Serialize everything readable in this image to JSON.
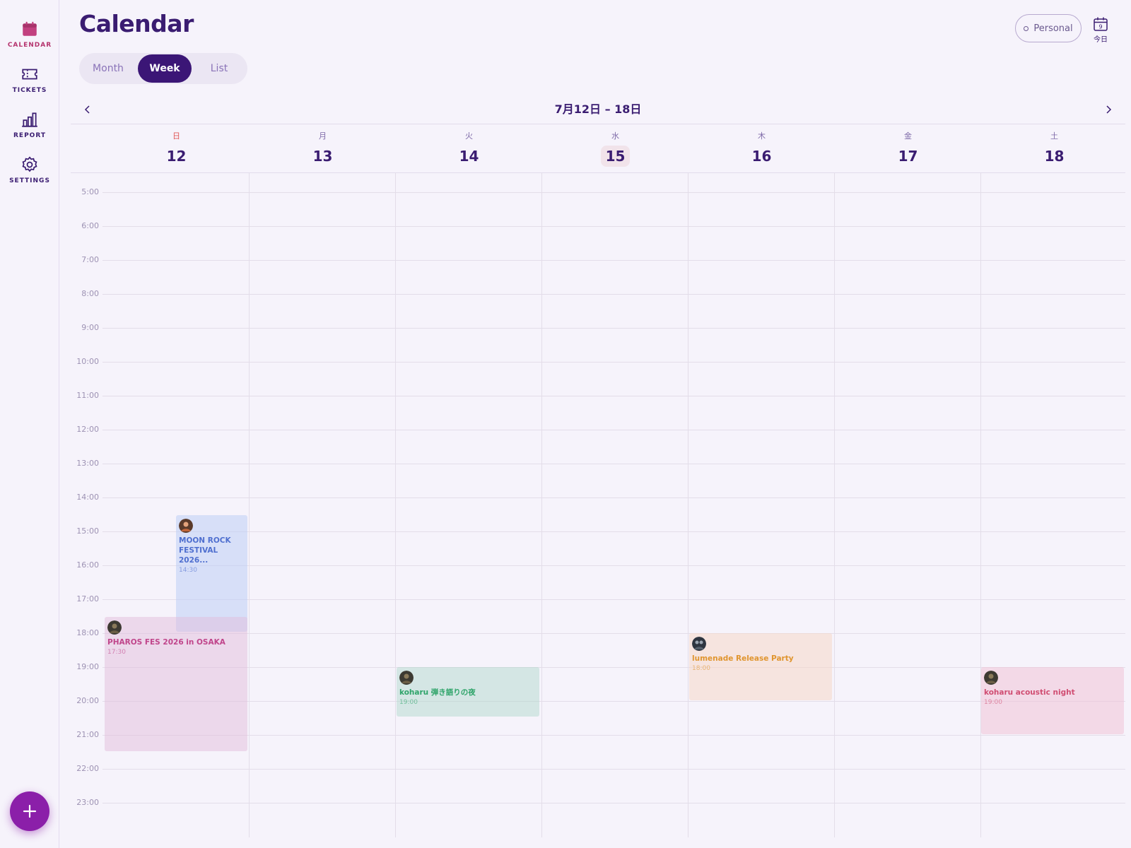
{
  "app": {
    "title": "Calendar"
  },
  "sidebar": {
    "items": [
      {
        "label": "CALENDAR",
        "icon": "calendar-icon",
        "active": true
      },
      {
        "label": "TICKETS",
        "icon": "ticket-icon",
        "active": false
      },
      {
        "label": "REPORT",
        "icon": "bar-chart-icon",
        "active": false
      },
      {
        "label": "SETTINGS",
        "icon": "gear-icon",
        "active": false
      }
    ],
    "fab_icon": "plus-icon"
  },
  "header": {
    "views": [
      "Month",
      "Week",
      "List"
    ],
    "active_view": "Week",
    "filter_label": "Personal",
    "today_label": "今日",
    "today_icon_day": "9"
  },
  "week": {
    "range_title": "7月12日 – 18日",
    "days": [
      {
        "dow": "日",
        "num": "12",
        "today": false
      },
      {
        "dow": "月",
        "num": "13",
        "today": false
      },
      {
        "dow": "火",
        "num": "14",
        "today": false
      },
      {
        "dow": "水",
        "num": "15",
        "today": true
      },
      {
        "dow": "木",
        "num": "16",
        "today": false
      },
      {
        "dow": "金",
        "num": "17",
        "today": false
      },
      {
        "dow": "土",
        "num": "18",
        "today": false
      }
    ],
    "hours": [
      "5:00",
      "6:00",
      "7:00",
      "8:00",
      "9:00",
      "10:00",
      "11:00",
      "12:00",
      "13:00",
      "14:00",
      "15:00",
      "16:00",
      "17:00",
      "18:00",
      "19:00",
      "20:00",
      "21:00",
      "22:00",
      "23:00"
    ]
  },
  "events": [
    {
      "title": "MOON ROCK FESTIVAL 2026...",
      "time": "14:30",
      "day": "12",
      "color": "#4f6fcf"
    },
    {
      "title": "PHAROS FES 2026 in OSAKA",
      "time": "17:30",
      "day": "12",
      "color": "#c0458b"
    },
    {
      "title": "koharu 弾き語りの夜",
      "time": "19:00",
      "day": "14",
      "color": "#2fa46a"
    },
    {
      "title": "lumenade Release Party",
      "time": "18:00",
      "day": "16",
      "color": "#e0952f"
    },
    {
      "title": "koharu acoustic night",
      "time": "19:00",
      "day": "18",
      "color": "#d04d72"
    }
  ],
  "colors": {
    "brand": "#3b1676",
    "accent": "#b5346e",
    "fab": "#8b1fa9",
    "today_highlight": "#f1e3ea",
    "sunday": "#e15a5a"
  }
}
